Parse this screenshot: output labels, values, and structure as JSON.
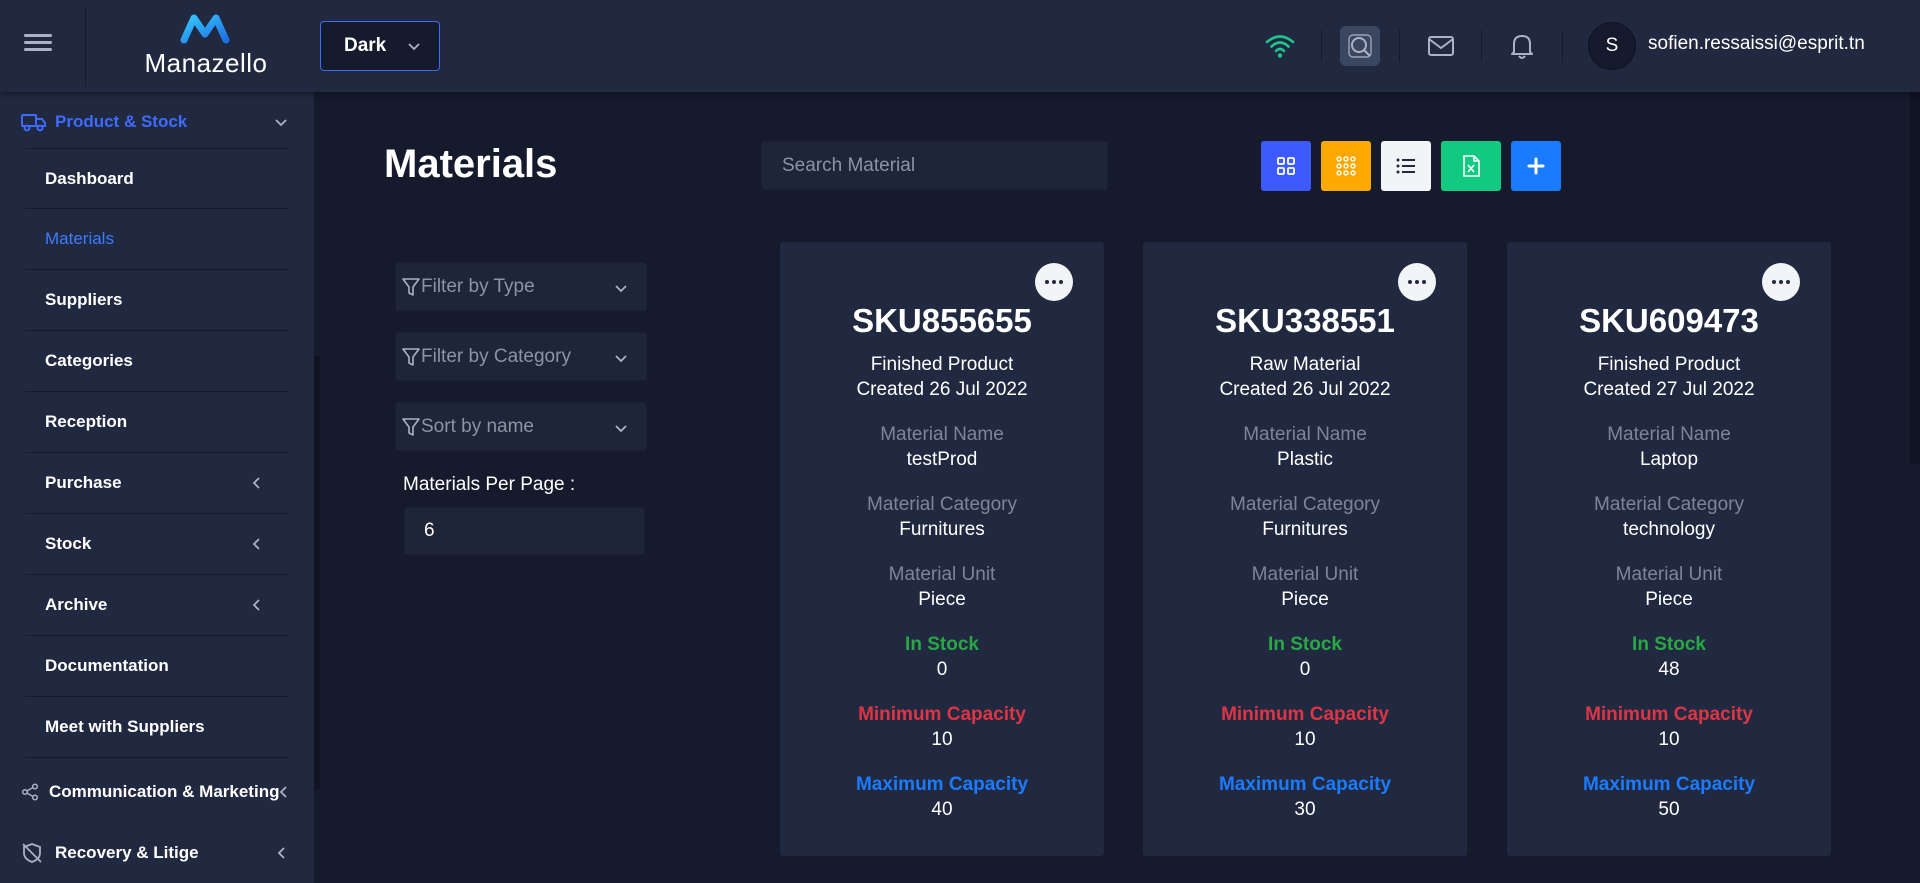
{
  "header": {
    "brand": "Manazello",
    "theme_value": "Dark",
    "user_initial": "S",
    "user_email": "sofien.ressaissi@esprit.tn",
    "wifi_color": "#1fc58d"
  },
  "sidebar": {
    "section_top": "Product & Stock",
    "items": [
      {
        "label": "Dashboard"
      },
      {
        "label": "Materials"
      },
      {
        "label": "Suppliers"
      },
      {
        "label": "Categories"
      },
      {
        "label": "Reception"
      },
      {
        "label": "Purchase"
      },
      {
        "label": "Stock"
      },
      {
        "label": "Archive"
      },
      {
        "label": "Documentation"
      },
      {
        "label": "Meet with Suppliers"
      }
    ],
    "section_comm": "Communication & Marketing",
    "section_recovery": "Recovery & Litige"
  },
  "main": {
    "title": "Materials",
    "search_placeholder": "Search Material",
    "toolbar_colors": {
      "grid": "#3d5afe",
      "grid_small": "#ffa800",
      "list": "#f3f4f8",
      "excel": "#12c982",
      "add": "#1b7bff"
    },
    "filters": {
      "type": "Filter by Type",
      "category": "Filter by Category",
      "sort": "Sort by name"
    },
    "per_page_label": "Materials Per Page :",
    "per_page_value": "6",
    "labels": {
      "name": "Material Name",
      "category": "Material Category",
      "unit": "Material Unit",
      "in_stock": "In Stock",
      "min": "Minimum Capacity",
      "max": "Maximum Capacity"
    },
    "cards": [
      {
        "sku": "SKU855655",
        "type": "Finished Product",
        "created": "Created 26 Jul 2022",
        "name": "testProd",
        "category": "Furnitures",
        "unit": "Piece",
        "in_stock": "0",
        "min": "10",
        "max": "40"
      },
      {
        "sku": "SKU338551",
        "type": "Raw Material",
        "created": "Created 26 Jul 2022",
        "name": "Plastic",
        "category": "Furnitures",
        "unit": "Piece",
        "in_stock": "0",
        "min": "10",
        "max": "30"
      },
      {
        "sku": "SKU609473",
        "type": "Finished Product",
        "created": "Created 27 Jul 2022",
        "name": "Laptop",
        "category": "technology",
        "unit": "Piece",
        "in_stock": "48",
        "min": "10",
        "max": "50"
      }
    ]
  }
}
